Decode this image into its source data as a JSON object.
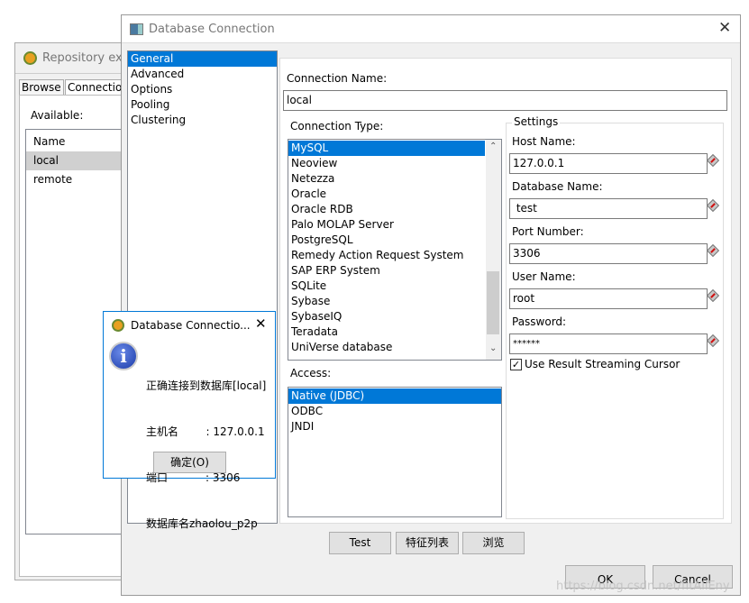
{
  "repo_window": {
    "title": "Repository exp",
    "tabs": [
      "Browse",
      "Connection"
    ],
    "available_label": "Available:",
    "column": "Name",
    "rows": [
      "local",
      "remote"
    ],
    "selected": "local"
  },
  "dialog": {
    "title": "Database Connection",
    "nav": [
      "General",
      "Advanced",
      "Options",
      "Pooling",
      "Clustering"
    ],
    "nav_selected": "General",
    "connection_name_label": "Connection Name:",
    "connection_name": "local",
    "connection_type_label": "Connection Type:",
    "connection_types": [
      "MySQL",
      "Neoview",
      "Netezza",
      "Oracle",
      "Oracle RDB",
      "Palo MOLAP Server",
      "PostgreSQL",
      "Remedy Action Request System",
      "SAP ERP System",
      "SQLite",
      "Sybase",
      "SybaseIQ",
      "Teradata",
      "UniVerse database"
    ],
    "connection_type_selected": "MySQL",
    "access_label": "Access:",
    "access": [
      "Native (JDBC)",
      "ODBC",
      "JNDI"
    ],
    "access_selected": "Native (JDBC)",
    "settings": {
      "legend": "Settings",
      "host_label": "Host Name:",
      "host": "127.0.0.1",
      "db_label": "Database Name:",
      "db": " test",
      "port_label": "Port Number:",
      "port": "3306",
      "user_label": "User Name:",
      "user": "root",
      "password_label": "Password:",
      "password": "******",
      "streaming_label": "Use Result Streaming Cursor",
      "streaming_checked": true
    },
    "buttons": {
      "test": "Test",
      "features": "特征列表",
      "explore": "浏览",
      "ok": "OK",
      "cancel": "Cancel"
    }
  },
  "message": {
    "title": "Database Connectio...",
    "lines": [
      "正确连接到数据库[local]",
      "主机名        : 127.0.0.1",
      "端口           : 3306",
      "数据库名zhaolou_p2p"
    ],
    "ok": "确定(O)"
  },
  "watermark": "https://blog.csdn.net/fitAllEny",
  "colors": {
    "selection": "#0078d7",
    "required": "#d01010"
  }
}
